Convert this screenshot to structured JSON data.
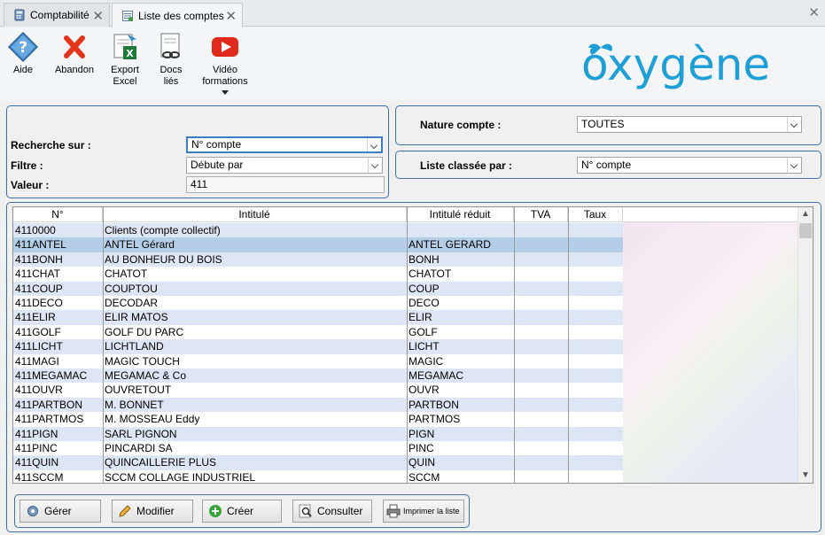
{
  "tabs": [
    {
      "label": "Comptabilité",
      "active": false
    },
    {
      "label": "Liste des comptes",
      "active": true
    }
  ],
  "toolbar": {
    "aide": "Aide",
    "abandon": "Abandon",
    "export_l1": "Export",
    "export_l2": "Excel",
    "docs_l1": "Docs",
    "docs_l2": "liés",
    "video_l1": "Vidéo",
    "video_l2": "formations"
  },
  "logo_text": "oxygène",
  "search": {
    "recherche_label": "Recherche sur :",
    "recherche_value": "N° compte",
    "filtre_label": "Filtre :",
    "filtre_value": "Débute par",
    "valeur_label": "Valeur :",
    "valeur_value": "411"
  },
  "nature": {
    "label": "Nature compte :",
    "value": "TOUTES"
  },
  "classee": {
    "label": "Liste classée par :",
    "value": "N° compte"
  },
  "grid": {
    "columns": [
      "N°",
      "Intitulé",
      "Intitulé réduit",
      "TVA",
      "Taux"
    ],
    "rows": [
      {
        "num": "4110000",
        "intitule": "Clients (compte collectif)",
        "reduit": ""
      },
      {
        "num": "411ANTEL",
        "intitule": "ANTEL Gérard",
        "reduit": "ANTEL GERARD"
      },
      {
        "num": "411BONH",
        "intitule": "AU BONHEUR DU BOIS",
        "reduit": "BONH"
      },
      {
        "num": "411CHAT",
        "intitule": "CHATOT",
        "reduit": "CHATOT"
      },
      {
        "num": "411COUP",
        "intitule": "COUPTOU",
        "reduit": "COUP"
      },
      {
        "num": "411DECO",
        "intitule": "DECODAR",
        "reduit": "DECO"
      },
      {
        "num": "411ELIR",
        "intitule": "ELIR MATOS",
        "reduit": "ELIR"
      },
      {
        "num": "411GOLF",
        "intitule": "GOLF DU PARC",
        "reduit": "GOLF"
      },
      {
        "num": "411LICHT",
        "intitule": "LICHTLAND",
        "reduit": "LICHT"
      },
      {
        "num": "411MAGI",
        "intitule": "MAGIC TOUCH",
        "reduit": "MAGIC"
      },
      {
        "num": "411MEGAMAC",
        "intitule": "MEGAMAC & Co",
        "reduit": "MEGAMAC"
      },
      {
        "num": "411OUVR",
        "intitule": "OUVRETOUT",
        "reduit": "OUVR"
      },
      {
        "num": "411PARTBON",
        "intitule": "M. BONNET",
        "reduit": "PARTBON"
      },
      {
        "num": "411PARTMOS",
        "intitule": "M. MOSSEAU Eddy",
        "reduit": "PARTMOS"
      },
      {
        "num": "411PIGN",
        "intitule": "SARL PIGNON",
        "reduit": "PIGN"
      },
      {
        "num": "411PINC",
        "intitule": "PINCARDI SA",
        "reduit": "PINC"
      },
      {
        "num": "411QUIN",
        "intitule": "QUINCAILLERIE PLUS",
        "reduit": "QUIN"
      },
      {
        "num": "411SCCM",
        "intitule": "SCCM COLLAGE INDUSTRIEL",
        "reduit": "SCCM"
      }
    ],
    "selected_row": 1
  },
  "buttons": {
    "gerer": "Gérer",
    "modifier": "Modifier",
    "creer": "Créer",
    "consulter": "Consulter",
    "imprimer": "Imprimer la liste"
  },
  "colors": {
    "accent": "#3f6fa8",
    "logo": "#1f9fd6",
    "row_alt": "#dde6f4",
    "row_selected": "#b5cde6"
  }
}
